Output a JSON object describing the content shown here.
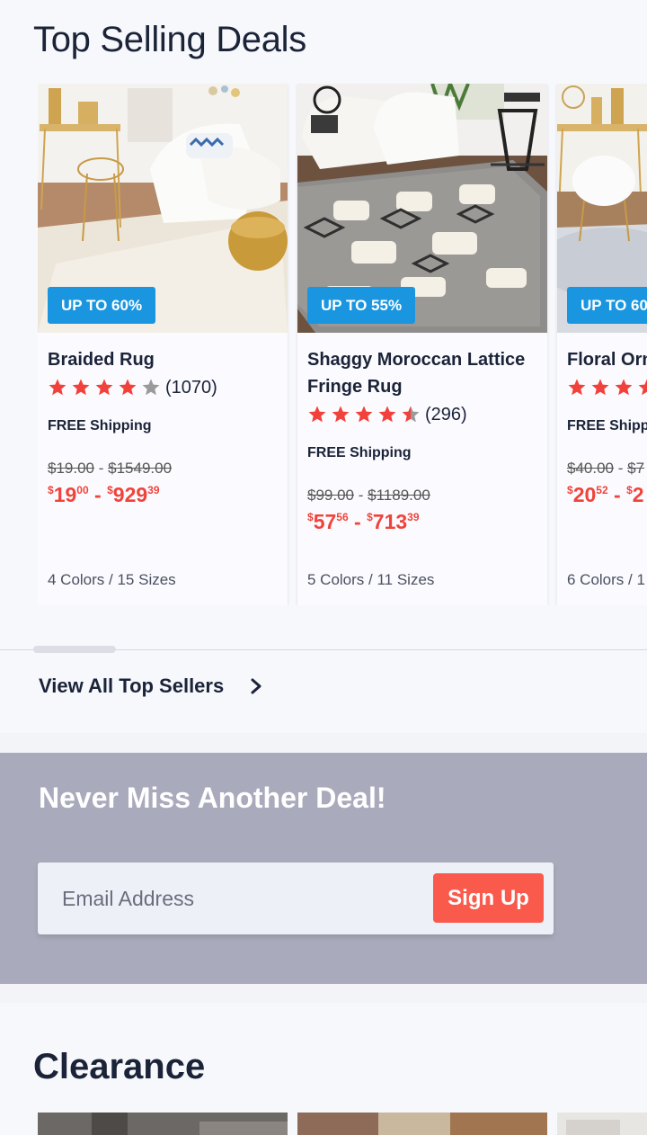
{
  "top_selling": {
    "title": "Top Selling Deals",
    "products": [
      {
        "badge": "UP TO 60%",
        "name": "Braided Rug",
        "stars": 4,
        "review_count": "(1070)",
        "shipping": "FREE Shipping",
        "old_low": "$19.00",
        "old_high": "$1549.00",
        "price_low_dollars": "19",
        "price_low_cents": "00",
        "price_high_dollars": "929",
        "price_high_cents": "39",
        "currency": "$",
        "separator": "-",
        "options": "4 Colors / 15 Sizes"
      },
      {
        "badge": "UP TO 55%",
        "name": "Shaggy Moroccan Lattice Fringe Rug",
        "stars": 4.5,
        "review_count": "(296)",
        "shipping": "FREE Shipping",
        "old_low": "$99.00",
        "old_high": "$1189.00",
        "price_low_dollars": "57",
        "price_low_cents": "56",
        "price_high_dollars": "713",
        "price_high_cents": "39",
        "currency": "$",
        "separator": "-",
        "options": "5 Colors / 11 Sizes"
      },
      {
        "badge": "UP TO 60",
        "name": "Floral Orn",
        "stars": 4,
        "review_count": "",
        "shipping": "FREE Shipp",
        "old_low": "$40.00",
        "old_high": "$7",
        "price_low_dollars": "20",
        "price_low_cents": "52",
        "price_high_dollars": "2",
        "price_high_cents": "",
        "currency": "$",
        "separator": "-",
        "options": "6 Colors / 1"
      }
    ],
    "view_all": "View All Top Sellers"
  },
  "newsletter": {
    "title": "Never Miss Another Deal!",
    "email_placeholder": "Email Address",
    "signup_label": "Sign Up"
  },
  "clearance": {
    "title": "Clearance"
  },
  "colors": {
    "badge": "#1a96e0",
    "sale_price": "#f0433a",
    "signup_button": "#fa5a4c",
    "newsletter_bg": "#a9abbc",
    "star": "#f2403a"
  }
}
